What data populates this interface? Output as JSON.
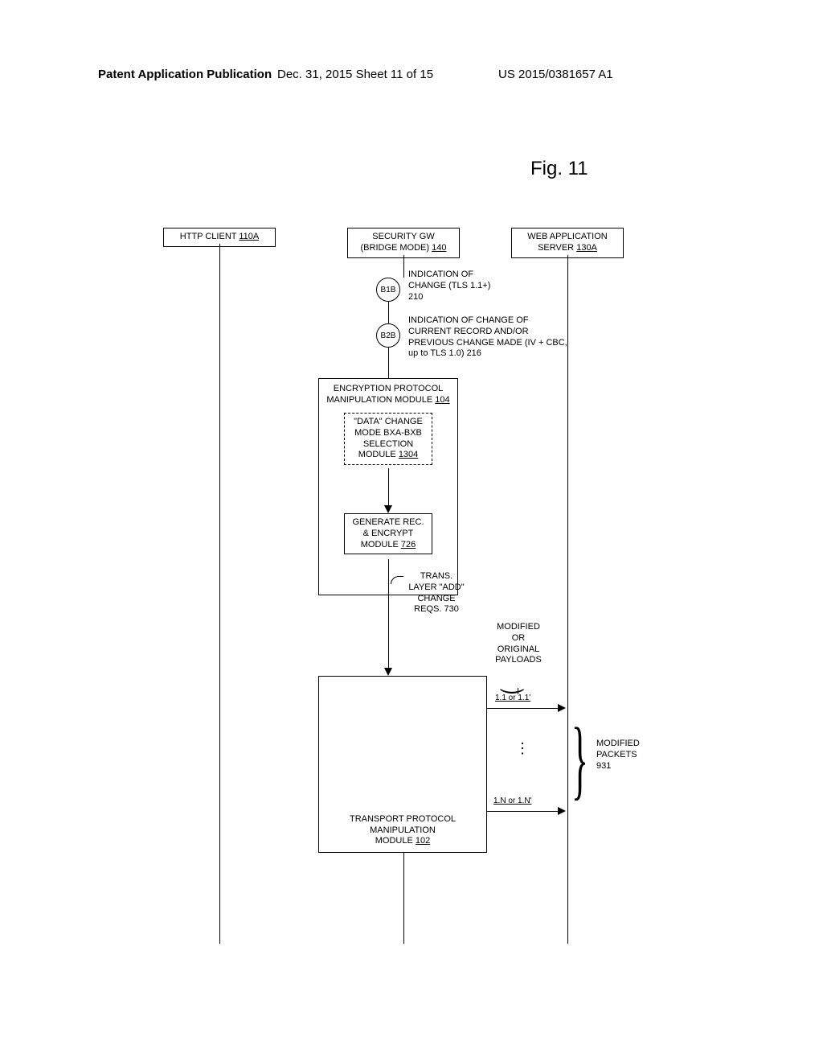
{
  "header": {
    "left": "Patent Application Publication",
    "mid": "Dec. 31, 2015  Sheet 11 of 15",
    "right": "US 2015/0381657 A1"
  },
  "fig_label": "Fig. 11",
  "actors": {
    "client": {
      "name": "HTTP CLIENT",
      "id": "110A"
    },
    "gw": {
      "name_l1": "SECURITY GW",
      "name_l2": "(BRIDGE MODE)",
      "id": "140"
    },
    "server": {
      "name_l1": "WEB APPLICATION",
      "name_l2": "SERVER",
      "id": "130A"
    }
  },
  "b1b": {
    "tag": "B1B",
    "l1": "INDICATION OF",
    "l2": "CHANGE  (TLS 1.1+)",
    "l3": "210"
  },
  "b2b": {
    "tag": "B2B",
    "l1": "INDICATION OF  CHANGE OF",
    "l2": "CURRENT RECORD AND/OR",
    "l3": "PREVIOUS CHANGE MADE (IV + CBC,",
    "l4": "up to TLS 1.0)  216"
  },
  "enc_mod": {
    "l1": "ENCRYPTION PROTOCOL",
    "l2": "MANIPULATION MODULE",
    "id": "104"
  },
  "data_change": {
    "l1": "\"DATA\" CHANGE",
    "l2": "MODE BXA-BXB",
    "l3": "SELECTION",
    "l4": "MODULE",
    "id": "1304"
  },
  "gen_enc": {
    "l1": "GENERATE REC.",
    "l2": "& ENCRYPT",
    "l3": "MODULE",
    "id": "726"
  },
  "trans_add": {
    "l1": "TRANS.",
    "l2": "LAYER \"ADD\"",
    "l3": "CHANGE",
    "l4": "REQS. 730"
  },
  "payloads": {
    "l1": "MODIFIED",
    "l2": "OR",
    "l3": "ORIGINAL",
    "l4": "PAYLOADS"
  },
  "pkt_first": "1.1 or 1.1'",
  "pkt_last": "1.N or 1.N'",
  "mod_packets": {
    "l1": "MODIFIED",
    "l2": "PACKETS",
    "l3": "931"
  },
  "tpm": {
    "l1": "TRANSPORT PROTOCOL MANIPULATION",
    "l2": "MODULE",
    "id": "102"
  }
}
